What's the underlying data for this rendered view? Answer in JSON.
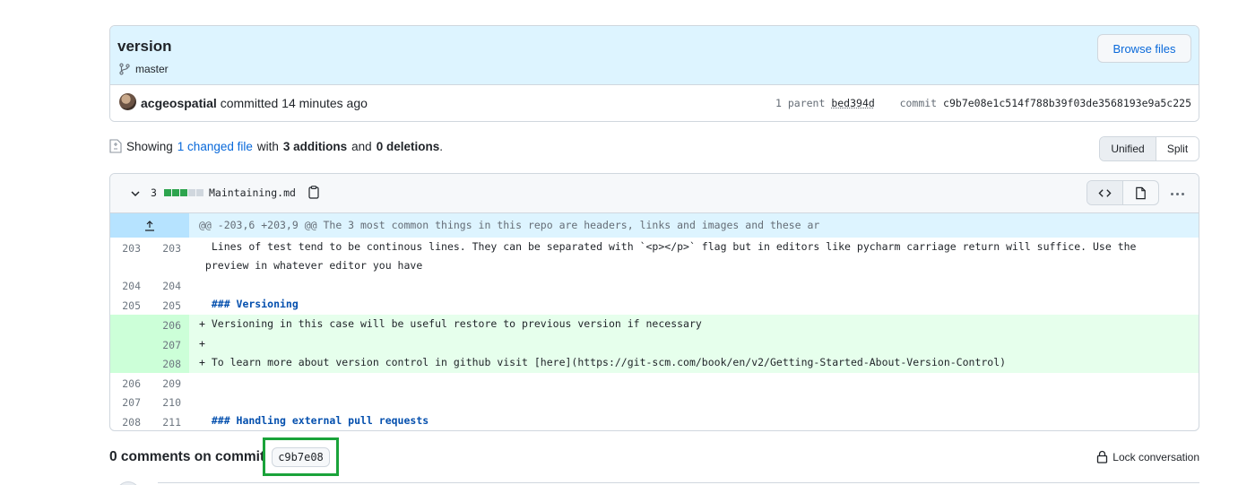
{
  "commit": {
    "title": "version",
    "branch": "master",
    "browse_label": "Browse files",
    "author": "acgeospatial",
    "action": "committed 14 minutes ago",
    "parent_label": "1 parent",
    "parent_sha": "bed394d",
    "commit_label": "commit",
    "commit_sha": "c9b7e08e1c514f788b39f03de3568193e9a5c225"
  },
  "summary": {
    "showing": "Showing",
    "changed_files": "1 changed file",
    "with": "with",
    "additions": "3 additions",
    "and": "and",
    "deletions": "0 deletions",
    "end": "."
  },
  "view_toggle": {
    "unified": "Unified",
    "split": "Split",
    "selected": "Unified"
  },
  "file": {
    "change_count": "3",
    "diffstat": [
      "added",
      "added",
      "added",
      "neutral",
      "neutral"
    ],
    "name": "Maintaining.md",
    "hunk_header": "@@ -203,6 +203,9 @@ The 3 most common things in this repo are headers, links and images and these ar",
    "lines": [
      {
        "old": "203",
        "new": "203",
        "type": "context",
        "text": "  Lines of test tend to be continous lines. They can be separated with `<p></p>` flag but in editors like pycharm carriage return will suffice. Use the\n preview in whatever editor you have"
      },
      {
        "old": "204",
        "new": "204",
        "type": "context",
        "text": " "
      },
      {
        "old": "205",
        "new": "205",
        "type": "context",
        "text": "  ### Versioning"
      },
      {
        "old": "",
        "new": "206",
        "type": "add",
        "text": "+ Versioning in this case will be useful restore to previous version if necessary"
      },
      {
        "old": "",
        "new": "207",
        "type": "add",
        "text": "+ "
      },
      {
        "old": "",
        "new": "208",
        "type": "add",
        "text": "+ To learn more about version control in github visit [here](https://git-scm.com/book/en/v2/Getting-Started-About-Version-Control)"
      },
      {
        "old": "206",
        "new": "209",
        "type": "context",
        "text": " "
      },
      {
        "old": "207",
        "new": "210",
        "type": "context",
        "text": " "
      },
      {
        "old": "208",
        "new": "211",
        "type": "context",
        "text": "  ### Handling external pull requests"
      }
    ]
  },
  "comments": {
    "heading": "0 comments on commit",
    "short_sha": "c9b7e08",
    "lock_label": "Lock conversation"
  },
  "colors": {
    "accent": "#0969da",
    "added_bg": "#e6ffec",
    "added_gutter": "#ccffd8",
    "hunk_bg": "#ddf4ff",
    "diffstat_added": "#2da44e",
    "diffstat_neutral": "#d0d7de",
    "highlight_border": "#1aa33a"
  }
}
